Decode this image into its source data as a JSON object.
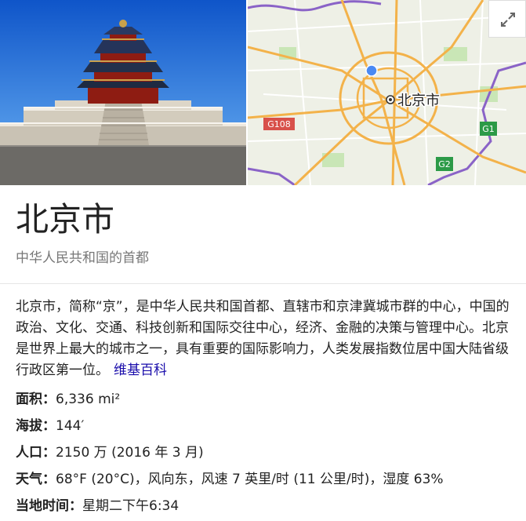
{
  "title": "北京市",
  "subtitle": "中华人民共和国的首都",
  "map": {
    "city_label": "北京市",
    "roads": [
      "G108",
      "G1",
      "G2"
    ]
  },
  "description": {
    "text": "北京市，简称“京”，是中华人民共和国首都、直辖市和京津冀城市群的中心，中国的政治、文化、交通、科技创新和国际交往中心，经济、金融的决策与管理中心。北京是世界上最大的城市之一，具有重要的国际影响力，人类发展指数位居中国大陆省级行政区第一位。",
    "source_link": "维基百科"
  },
  "facts": [
    {
      "label": "面积：",
      "value": "6,336 mi²"
    },
    {
      "label": "海拔：",
      "value": "144′"
    },
    {
      "label": "人口：",
      "value": "2150 万 (2016 年 3 月)"
    },
    {
      "label": "天气：",
      "value": "68°F (20°C)，风向东，风速 7 英里/时 (11 公里/时)，湿度 63%"
    },
    {
      "label": "当地时间：",
      "value": "星期二下午6:34"
    }
  ],
  "icons": {
    "expand": "expand-icon"
  }
}
